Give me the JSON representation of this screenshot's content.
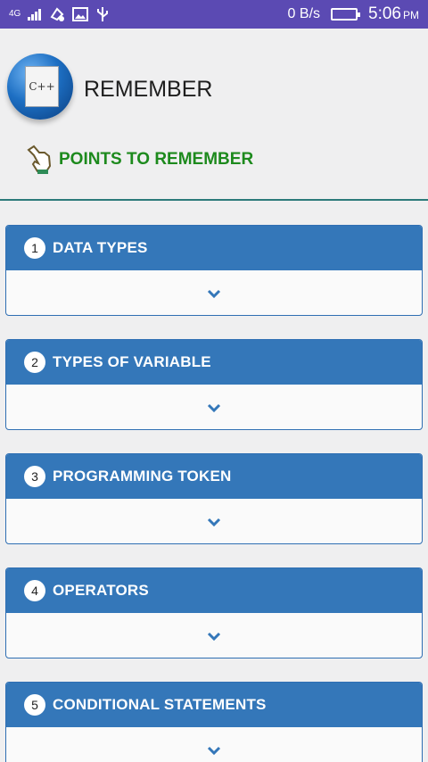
{
  "status_bar": {
    "network": "4G",
    "speed": "0 B/s",
    "time": "5:06",
    "ampm": "PM"
  },
  "header": {
    "logo_text": "C++",
    "title": "REMEMBER",
    "points_label": "POINTS TO REMEMBER"
  },
  "sections": [
    {
      "number": "1",
      "title": "DATA TYPES"
    },
    {
      "number": "2",
      "title": "TYPES OF VARIABLE"
    },
    {
      "number": "3",
      "title": "PROGRAMMING TOKEN"
    },
    {
      "number": "4",
      "title": "OPERATORS"
    },
    {
      "number": "5",
      "title": "CONDITIONAL STATEMENTS"
    }
  ],
  "icons": {
    "hand": "pointing-hand-icon",
    "expand": "chevron-down-icon"
  },
  "colors": {
    "status_bar": "#5b4ab3",
    "card_header": "#3477b9",
    "points_label": "#1d8a1d"
  }
}
